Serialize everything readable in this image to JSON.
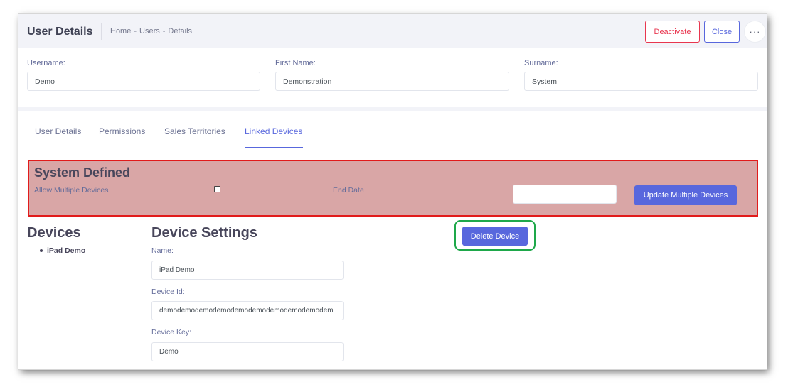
{
  "header": {
    "title": "User Details",
    "breadcrumb": [
      "Home",
      "-",
      "Users",
      "-",
      "Details"
    ],
    "deactivate_label": "Deactivate",
    "close_label": "Close",
    "more_label": "···"
  },
  "fields": {
    "username": {
      "label": "Username:",
      "value": "Demo"
    },
    "first_name": {
      "label": "First Name:",
      "value": "Demonstration"
    },
    "surname": {
      "label": "Surname:",
      "value": "System"
    }
  },
  "tabs": [
    {
      "label": "User Details",
      "active": false
    },
    {
      "label": "Permissions",
      "active": false
    },
    {
      "label": "Sales Territories",
      "active": false
    },
    {
      "label": "Linked Devices",
      "active": true
    }
  ],
  "system_defined": {
    "title": "System Defined",
    "allow_multiple_label": "Allow Multiple Devices",
    "allow_multiple_checked": false,
    "end_date_label": "End Date",
    "end_date_value": "",
    "update_button_label": "Update Multiple Devices",
    "highlight_color": "#e11b1b"
  },
  "devices": {
    "title": "Devices",
    "items": [
      "iPad Demo"
    ]
  },
  "device_settings": {
    "title": "Device Settings",
    "name_label": "Name:",
    "name_value": "iPad Demo",
    "device_id_label": "Device Id:",
    "device_id_value": "demodemodemodemodemodemodemodemodemodem",
    "device_key_label": "Device Key:",
    "device_key_value": "Demo"
  },
  "delete_button_label": "Delete Device",
  "colors": {
    "accent": "#5867dd",
    "danger": "#e8364f",
    "highlight_green": "#1ea84a"
  }
}
